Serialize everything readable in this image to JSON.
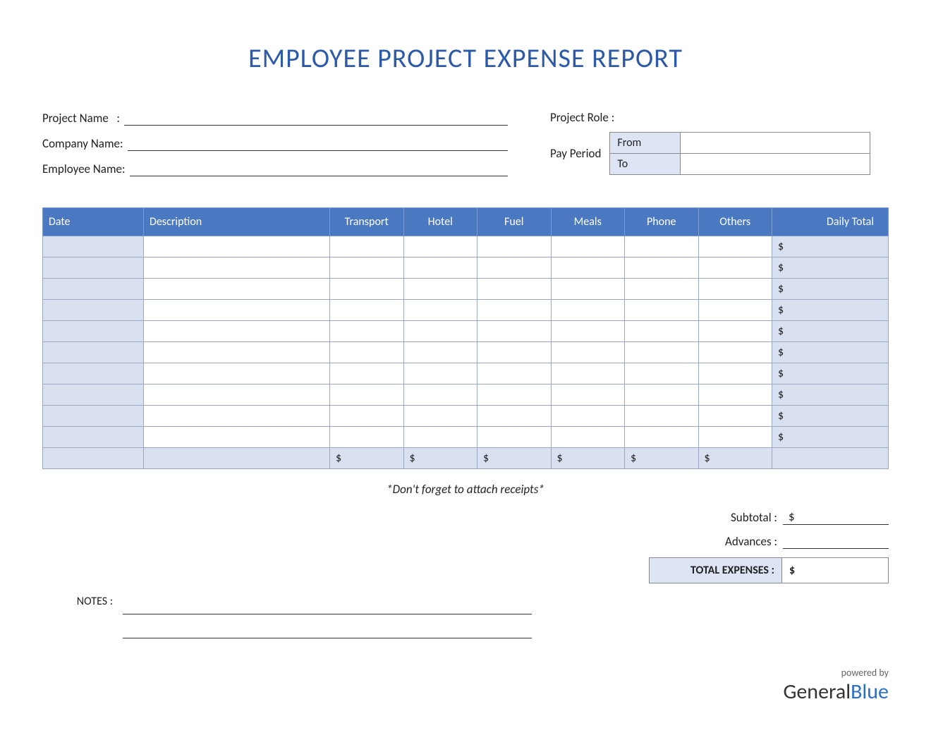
{
  "title": "EMPLOYEE PROJECT EXPENSE REPORT",
  "fields": {
    "project_name_label": "Project Name",
    "company_name_label": "Company Name:",
    "employee_name_label": "Employee Name:",
    "project_role_label": "Project Role :",
    "pay_period_label": "Pay Period",
    "from_label": "From",
    "to_label": "To",
    "project_name_value": "",
    "company_name_value": "",
    "employee_name_value": "",
    "project_role_value": "",
    "from_value": "",
    "to_value": ""
  },
  "columns": {
    "date": "Date",
    "description": "Description",
    "transport": "Transport",
    "hotel": "Hotel",
    "fuel": "Fuel",
    "meals": "Meals",
    "phone": "Phone",
    "others": "Others",
    "daily_total": "Daily Total"
  },
  "rows": [
    {
      "date": "",
      "description": "",
      "transport": "",
      "hotel": "",
      "fuel": "",
      "meals": "",
      "phone": "",
      "others": "",
      "daily_total": "$"
    },
    {
      "date": "",
      "description": "",
      "transport": "",
      "hotel": "",
      "fuel": "",
      "meals": "",
      "phone": "",
      "others": "",
      "daily_total": "$"
    },
    {
      "date": "",
      "description": "",
      "transport": "",
      "hotel": "",
      "fuel": "",
      "meals": "",
      "phone": "",
      "others": "",
      "daily_total": "$"
    },
    {
      "date": "",
      "description": "",
      "transport": "",
      "hotel": "",
      "fuel": "",
      "meals": "",
      "phone": "",
      "others": "",
      "daily_total": "$"
    },
    {
      "date": "",
      "description": "",
      "transport": "",
      "hotel": "",
      "fuel": "",
      "meals": "",
      "phone": "",
      "others": "",
      "daily_total": "$"
    },
    {
      "date": "",
      "description": "",
      "transport": "",
      "hotel": "",
      "fuel": "",
      "meals": "",
      "phone": "",
      "others": "",
      "daily_total": "$"
    },
    {
      "date": "",
      "description": "",
      "transport": "",
      "hotel": "",
      "fuel": "",
      "meals": "",
      "phone": "",
      "others": "",
      "daily_total": "$"
    },
    {
      "date": "",
      "description": "",
      "transport": "",
      "hotel": "",
      "fuel": "",
      "meals": "",
      "phone": "",
      "others": "",
      "daily_total": "$"
    },
    {
      "date": "",
      "description": "",
      "transport": "",
      "hotel": "",
      "fuel": "",
      "meals": "",
      "phone": "",
      "others": "",
      "daily_total": "$"
    },
    {
      "date": "",
      "description": "",
      "transport": "",
      "hotel": "",
      "fuel": "",
      "meals": "",
      "phone": "",
      "others": "",
      "daily_total": "$"
    }
  ],
  "column_totals": {
    "transport": "$",
    "hotel": "$",
    "fuel": "$",
    "meals": "$",
    "phone": "$",
    "others": "$"
  },
  "reminder": "*Don't forget to attach receipts*",
  "summary": {
    "subtotal_label": "Subtotal :",
    "subtotal_value": "$",
    "advances_label": "Advances :",
    "advances_value": "",
    "total_label": "TOTAL EXPENSES :",
    "total_value": "$"
  },
  "notes_label": "NOTES :",
  "footer": {
    "powered": "powered by",
    "brand_general": "General",
    "brand_blue": "Blue"
  }
}
